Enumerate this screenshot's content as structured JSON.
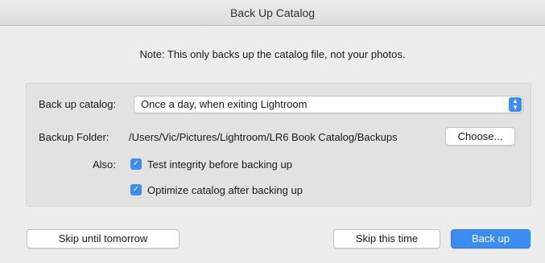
{
  "window": {
    "title": "Back Up Catalog"
  },
  "note": "Note: This only backs up the catalog file, not your photos.",
  "backup_catalog": {
    "label": "Back up catalog:",
    "selected": "Once a day, when exiting Lightroom"
  },
  "backup_folder": {
    "label": "Backup Folder:",
    "path": "/Users/Vic/Pictures/Lightroom/LR6 Book Catalog/Backups",
    "choose_label": "Choose..."
  },
  "also": {
    "label": "Also:",
    "options": [
      {
        "label": "Test integrity before backing up",
        "checked": true
      },
      {
        "label": "Optimize catalog after backing up",
        "checked": true
      }
    ]
  },
  "buttons": {
    "skip_tomorrow": "Skip until tomorrow",
    "skip_this_time": "Skip this time",
    "back_up": "Back up"
  },
  "colors": {
    "accent": "#3d8cf2",
    "background": "#ececec",
    "panel": "#e2e2e2"
  }
}
